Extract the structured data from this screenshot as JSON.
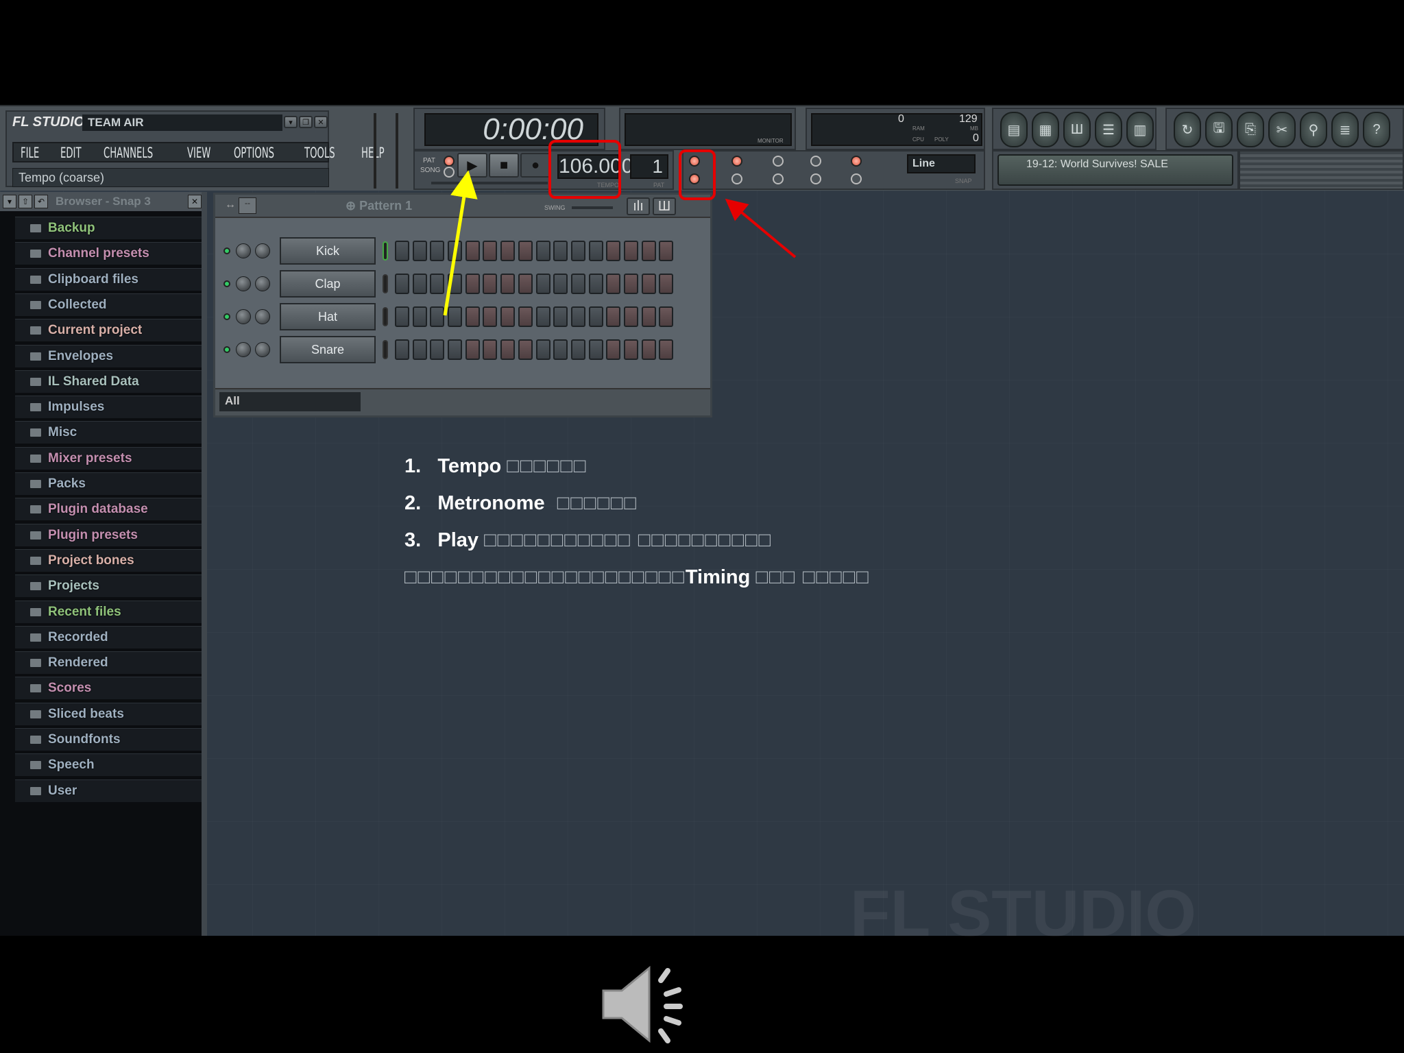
{
  "app": {
    "logo": "FL STUDIO",
    "title": "TEAM AIR",
    "hint": "Tempo (coarse)"
  },
  "menu": [
    "FILE",
    "EDIT",
    "CHANNELS",
    "VIEW",
    "OPTIONS",
    "TOOLS",
    "HELP"
  ],
  "transport": {
    "time": "0:00:00",
    "pat_label": "PAT",
    "song_label": "SONG",
    "tempo": "106.000",
    "tempo_label": "TEMPO",
    "pattern_num": "1",
    "pat_caption": "PAT"
  },
  "monitor": {
    "label": "MONITOR",
    "ram_label": "RAM",
    "mb_label": "MB",
    "cpu_label": "CPU",
    "poly_label": "POLY",
    "cpu": "0",
    "ram": "129",
    "poly": "0"
  },
  "snap": {
    "value": "Line",
    "label": "SNAP"
  },
  "news": "19-12: World Survives! SALE",
  "browser": {
    "title": "Browser - Snap 3",
    "items": [
      {
        "label": "Backup",
        "color": "#8fc27a"
      },
      {
        "label": "Channel presets",
        "color": "#c48fb0"
      },
      {
        "label": "Clipboard files",
        "color": "#9fb0c0"
      },
      {
        "label": "Collected",
        "color": "#9fb0c0"
      },
      {
        "label": "Current project",
        "color": "#d8b0a8"
      },
      {
        "label": "Envelopes",
        "color": "#9fb0c0"
      },
      {
        "label": "IL Shared Data",
        "color": "#a8c0bc"
      },
      {
        "label": "Impulses",
        "color": "#9fb0c0"
      },
      {
        "label": "Misc",
        "color": "#9fb0c0"
      },
      {
        "label": "Mixer presets",
        "color": "#c48fb0"
      },
      {
        "label": "Packs",
        "color": "#9fb0c0"
      },
      {
        "label": "Plugin database",
        "color": "#c48fb0"
      },
      {
        "label": "Plugin presets",
        "color": "#c48fb0"
      },
      {
        "label": "Project bones",
        "color": "#d8b0a8"
      },
      {
        "label": "Projects",
        "color": "#a8c0bc"
      },
      {
        "label": "Recent files",
        "color": "#8fc27a"
      },
      {
        "label": "Recorded",
        "color": "#9fb0c0"
      },
      {
        "label": "Rendered",
        "color": "#9fb0c0"
      },
      {
        "label": "Scores",
        "color": "#c48fb0"
      },
      {
        "label": "Sliced beats",
        "color": "#9fb0c0"
      },
      {
        "label": "Soundfonts",
        "color": "#9fb0c0"
      },
      {
        "label": "Speech",
        "color": "#9fb0c0"
      },
      {
        "label": "User",
        "color": "#9fb0c0"
      }
    ]
  },
  "rack": {
    "pattern": "Pattern 1",
    "swing_label": "SWING",
    "filter": "All",
    "channels": [
      "Kick",
      "Clap",
      "Hat",
      "Snare"
    ],
    "steps": 16
  },
  "notes": [
    {
      "num": "1.",
      "bold": "Tempo",
      "rest": "□□□□□□"
    },
    {
      "num": "2.",
      "bold": "Metronome",
      "rest": " □□□□□□"
    },
    {
      "num": "3.",
      "bold": "Play",
      "rest": "□□□□□□□□□□□ □□□□□□□□□□"
    },
    {
      "pre": "□□□□□□□□□□□□□□□□□□□□□",
      "bold": "Timing",
      "rest": "□□□ □□□□□"
    }
  ],
  "annotation_colors": {
    "highlight": "#e60000",
    "arrow_play": "#ffff00",
    "arrow_metronome": "#e60000"
  },
  "watermark": "FL STUDIO"
}
